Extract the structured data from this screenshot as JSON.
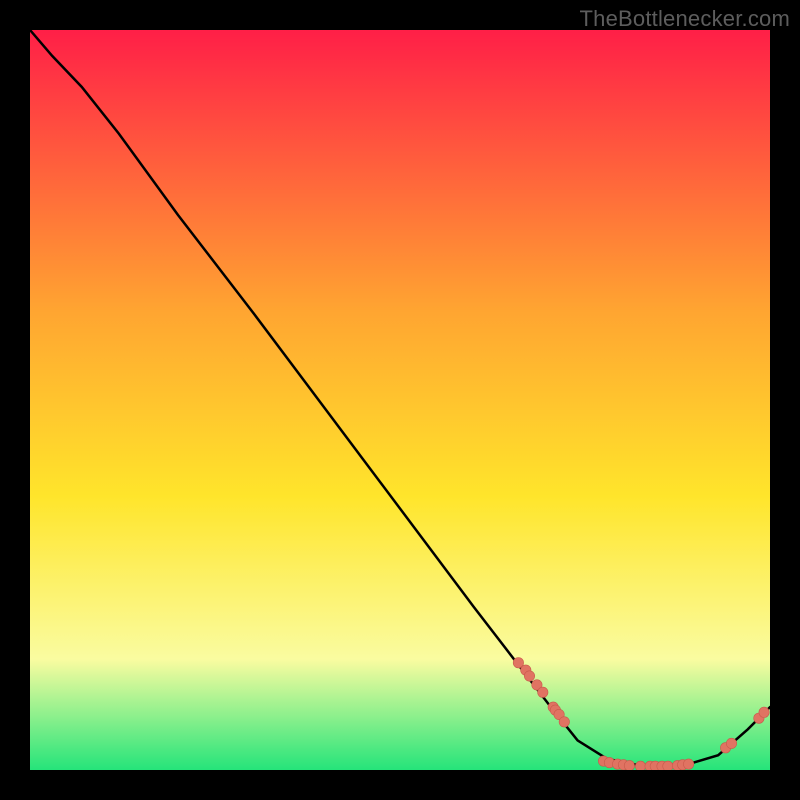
{
  "watermark": "TheBottlenecker.com",
  "colors": {
    "frame_bg": "#000000",
    "line": "#000000",
    "dot_fill": "#e07362",
    "dot_stroke": "#c95a4c",
    "gradient_top": "#ff1f47",
    "gradient_mid1": "#ffa531",
    "gradient_mid2": "#ffe52b",
    "gradient_mid3": "#fafca0",
    "gradient_bottom": "#25e47a"
  },
  "chart_data": {
    "type": "line",
    "title": "",
    "xlabel": "",
    "ylabel": "",
    "xlim": [
      0,
      100
    ],
    "ylim": [
      0,
      100
    ],
    "line_points": [
      {
        "x": 0,
        "y": 100
      },
      {
        "x": 3,
        "y": 96.5
      },
      {
        "x": 7,
        "y": 92.3
      },
      {
        "x": 12,
        "y": 86
      },
      {
        "x": 20,
        "y": 75
      },
      {
        "x": 30,
        "y": 62
      },
      {
        "x": 45,
        "y": 42
      },
      {
        "x": 60,
        "y": 22
      },
      {
        "x": 70,
        "y": 9
      },
      {
        "x": 74,
        "y": 4
      },
      {
        "x": 78,
        "y": 1.5
      },
      {
        "x": 83,
        "y": 0.5
      },
      {
        "x": 88,
        "y": 0.5
      },
      {
        "x": 93,
        "y": 2
      },
      {
        "x": 97,
        "y": 5.5
      },
      {
        "x": 100,
        "y": 8.5
      }
    ],
    "dot_clusters": [
      {
        "x": 66,
        "y": 14.5
      },
      {
        "x": 67,
        "y": 13.5
      },
      {
        "x": 67.5,
        "y": 12.7
      },
      {
        "x": 68.5,
        "y": 11.5
      },
      {
        "x": 69.3,
        "y": 10.5
      },
      {
        "x": 70.7,
        "y": 8.5
      },
      {
        "x": 71.0,
        "y": 8.1
      },
      {
        "x": 71.5,
        "y": 7.5
      },
      {
        "x": 72.2,
        "y": 6.5
      },
      {
        "x": 77.5,
        "y": 1.2
      },
      {
        "x": 78.3,
        "y": 1.0
      },
      {
        "x": 79.4,
        "y": 0.8
      },
      {
        "x": 80.2,
        "y": 0.7
      },
      {
        "x": 81.0,
        "y": 0.6
      },
      {
        "x": 82.5,
        "y": 0.5
      },
      {
        "x": 83.8,
        "y": 0.5
      },
      {
        "x": 84.5,
        "y": 0.5
      },
      {
        "x": 85.4,
        "y": 0.5
      },
      {
        "x": 86.2,
        "y": 0.5
      },
      {
        "x": 87.5,
        "y": 0.6
      },
      {
        "x": 88.2,
        "y": 0.7
      },
      {
        "x": 89,
        "y": 0.8
      },
      {
        "x": 94,
        "y": 3.0
      },
      {
        "x": 94.8,
        "y": 3.6
      },
      {
        "x": 98.5,
        "y": 7.0
      },
      {
        "x": 99.2,
        "y": 7.8
      }
    ]
  }
}
